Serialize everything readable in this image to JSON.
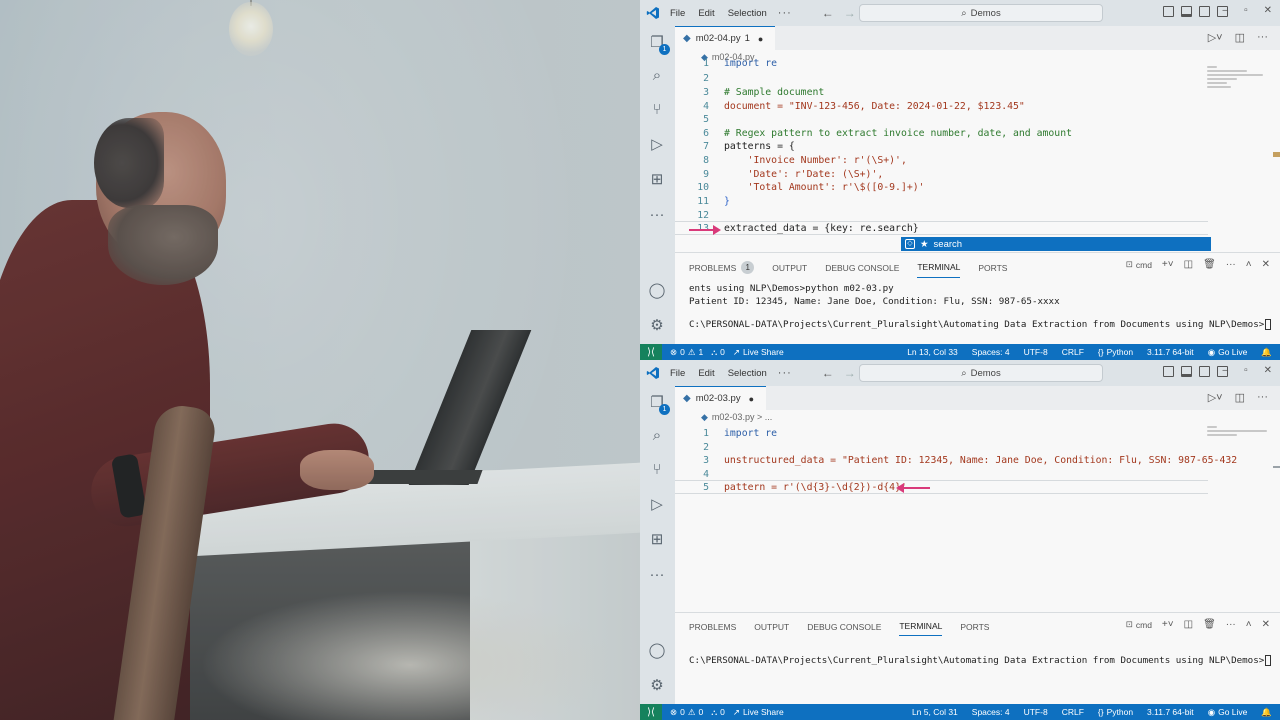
{
  "window1": {
    "menu": [
      "File",
      "Edit",
      "Selection"
    ],
    "search": "Demos",
    "tab": {
      "name": "m02-04.py",
      "badge": "1"
    },
    "breadcrumb": "m02-04.py",
    "code": [
      {
        "n": "1",
        "t": "import re"
      },
      {
        "n": "2",
        "t": ""
      },
      {
        "n": "3",
        "t": "# Sample document"
      },
      {
        "n": "4",
        "t": "document = \"INV-123-456, Date: 2024-01-22, $123.45\""
      },
      {
        "n": "5",
        "t": ""
      },
      {
        "n": "6",
        "t": "# Regex pattern to extract invoice number, date, and amount"
      },
      {
        "n": "7",
        "t": "patterns = {"
      },
      {
        "n": "8",
        "t": "    'Invoice Number': r'(\\S+)',"
      },
      {
        "n": "9",
        "t": "    'Date': r'Date: (\\S+)',"
      },
      {
        "n": "10",
        "t": "    'Total Amount': r'\\$([0-9.]+)'"
      },
      {
        "n": "11",
        "t": "}"
      },
      {
        "n": "12",
        "t": ""
      },
      {
        "n": "13",
        "t": "extracted_data = {key: re.search}"
      }
    ],
    "suggestion": "search",
    "panel_tabs": [
      "PROBLEMS",
      "OUTPUT",
      "DEBUG CONSOLE",
      "TERMINAL",
      "PORTS"
    ],
    "problems_count": "1",
    "terminal": [
      "ents using NLP\\Demos>python m02-03.py",
      "Patient ID: 12345, Name: Jane Doe, Condition: Flu, SSN: 987-65-xxxx",
      "",
      "C:\\PERSONAL-DATA\\Projects\\Current_Pluralsight\\Automating Data Extraction from Documents using NLP\\Demos>"
    ],
    "shell": "cmd",
    "status": {
      "errors": "0",
      "warnings": "1",
      "ports": "0",
      "live_share": "Live Share",
      "position": "Ln 13, Col 33",
      "spaces": "Spaces: 4",
      "encoding": "UTF-8",
      "eol": "CRLF",
      "language": "Python",
      "interpreter": "3.11.7 64-bit",
      "golive": "Go Live"
    }
  },
  "window2": {
    "menu": [
      "File",
      "Edit",
      "Selection"
    ],
    "search": "Demos",
    "tab": {
      "name": "m02-03.py",
      "badge": ""
    },
    "breadcrumb": "m02-03.py > ...",
    "code": [
      {
        "n": "1",
        "t": "import re"
      },
      {
        "n": "2",
        "t": ""
      },
      {
        "n": "3",
        "t": "unstructured_data = \"Patient ID: 12345, Name: Jane Doe, Condition: Flu, SSN: 987-65-432"
      },
      {
        "n": "4",
        "t": ""
      },
      {
        "n": "5",
        "t": "pattern = r'(\\d{3}-\\d{2})-d{4}'"
      }
    ],
    "panel_tabs": [
      "PROBLEMS",
      "OUTPUT",
      "DEBUG CONSOLE",
      "TERMINAL",
      "PORTS"
    ],
    "terminal": [
      "C:\\PERSONAL-DATA\\Projects\\Current_Pluralsight\\Automating Data Extraction from Documents using NLP\\Demos>"
    ],
    "shell": "cmd",
    "status": {
      "errors": "0",
      "warnings": "0",
      "ports": "0",
      "live_share": "Live Share",
      "position": "Ln 5, Col 31",
      "spaces": "Spaces: 4",
      "encoding": "UTF-8",
      "eol": "CRLF",
      "language": "Python",
      "interpreter": "3.11.7 64-bit",
      "golive": "Go Live"
    }
  },
  "colors": {
    "accent": "#0e70c0",
    "arrow": "#d93a7a",
    "remote": "#16825d"
  },
  "icons": [
    "vscode-logo-icon",
    "explorer-icon",
    "search-icon",
    "source-control-icon",
    "run-debug-icon",
    "extensions-icon",
    "more-icon",
    "account-icon",
    "gear-icon",
    "python-file-icon",
    "run-icon",
    "split-editor-icon",
    "remote-icon",
    "error-icon",
    "warning-icon",
    "ports-icon",
    "live-share-icon",
    "braces-icon",
    "bell-icon"
  ]
}
